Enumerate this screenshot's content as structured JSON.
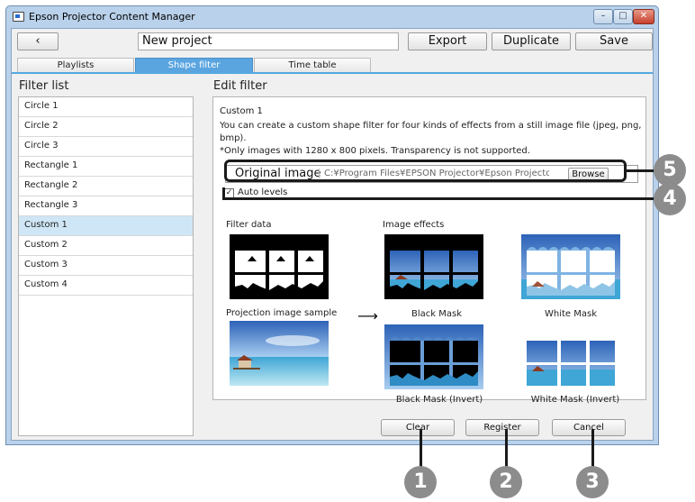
{
  "window": {
    "title": "Epson Projector Content Manager",
    "controls": {
      "minimize": "–",
      "maximize": "□",
      "close": "✕"
    }
  },
  "toolbar": {
    "back_label": "‹",
    "project_name": "New project",
    "export_label": "Export",
    "duplicate_label": "Duplicate",
    "save_label": "Save"
  },
  "tabs": [
    {
      "label": "Playlists",
      "active": false
    },
    {
      "label": "Shape filter",
      "active": true
    },
    {
      "label": "Time table",
      "active": false
    }
  ],
  "filter_list": {
    "heading": "Filter list",
    "items": [
      "Circle 1",
      "Circle 2",
      "Circle 3",
      "Rectangle 1",
      "Rectangle 2",
      "Rectangle 3",
      "Custom 1",
      "Custom 2",
      "Custom 3",
      "Custom 4"
    ],
    "selected": "Custom 1"
  },
  "edit_filter": {
    "heading": "Edit filter",
    "name": "Custom 1",
    "description_line1": "You can create a custom shape filter for four kinds of effects from a still image file (jpeg, png, bmp).",
    "description_line2": "*Only images with 1280 x 800 pixels. Transparency is not supported.",
    "original_image_label": "Original image",
    "original_image_path": "C:¥Program Files¥EPSON Projector¥Epson Projector Content Manag",
    "browse_label": "Browse",
    "auto_levels_label": "Auto levels",
    "auto_levels_checked": true,
    "filter_data_label": "Filter data",
    "image_effects_label": "Image effects",
    "projection_sample_label": "Projection image sample",
    "arrow": "⟶",
    "effects": {
      "black_mask": "Black Mask",
      "white_mask": "White Mask",
      "black_mask_invert": "Black Mask (Invert)",
      "white_mask_invert": "White Mask (Invert)"
    }
  },
  "actions": {
    "clear_label": "Clear",
    "register_label": "Register",
    "cancel_label": "Cancel"
  },
  "callouts": [
    "1",
    "2",
    "3",
    "4",
    "5"
  ]
}
